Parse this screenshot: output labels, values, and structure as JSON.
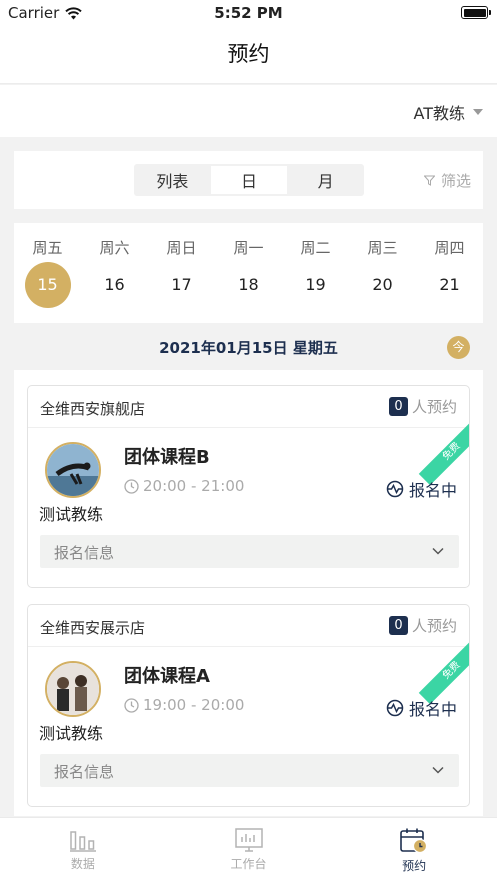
{
  "status_bar": {
    "carrier": "Carrier",
    "time": "5:52 PM"
  },
  "nav": {
    "title": "预约"
  },
  "coach_filter": {
    "selected": "AT教练"
  },
  "view_switch": {
    "options": [
      "列表",
      "日",
      "月"
    ],
    "active": "日",
    "filter_label": "筛选"
  },
  "week": {
    "days": [
      {
        "weekday": "周五",
        "date": "15",
        "selected": true
      },
      {
        "weekday": "周六",
        "date": "16"
      },
      {
        "weekday": "周日",
        "date": "17"
      },
      {
        "weekday": "周一",
        "date": "18"
      },
      {
        "weekday": "周二",
        "date": "19"
      },
      {
        "weekday": "周三",
        "date": "20"
      },
      {
        "weekday": "周四",
        "date": "21"
      }
    ]
  },
  "date_header": {
    "text": "2021年01月15日 星期五",
    "today_badge": "今"
  },
  "courses": [
    {
      "store": "全维西安旗舰店",
      "booking_count": "0",
      "booking_suffix": "人预约",
      "tag": "免费",
      "coach": "测试教练",
      "title": "团体课程B",
      "time": "20:00 - 21:00",
      "status": "报名中",
      "info_label": "报名信息"
    },
    {
      "store": "全维西安展示店",
      "booking_count": "0",
      "booking_suffix": "人预约",
      "tag": "免费",
      "coach": "测试教练",
      "title": "团体课程A",
      "time": "19:00 - 20:00",
      "status": "报名中",
      "info_label": "报名信息"
    }
  ],
  "tabs": [
    {
      "label": "数据",
      "icon": "bar-chart-icon"
    },
    {
      "label": "工作台",
      "icon": "dashboard-icon"
    },
    {
      "label": "预约",
      "icon": "calendar-clock-icon",
      "active": true
    }
  ],
  "colors": {
    "accent_gold": "#d3b063",
    "navy": "#1d2f4f",
    "free_tag": "#3bd5a4"
  }
}
